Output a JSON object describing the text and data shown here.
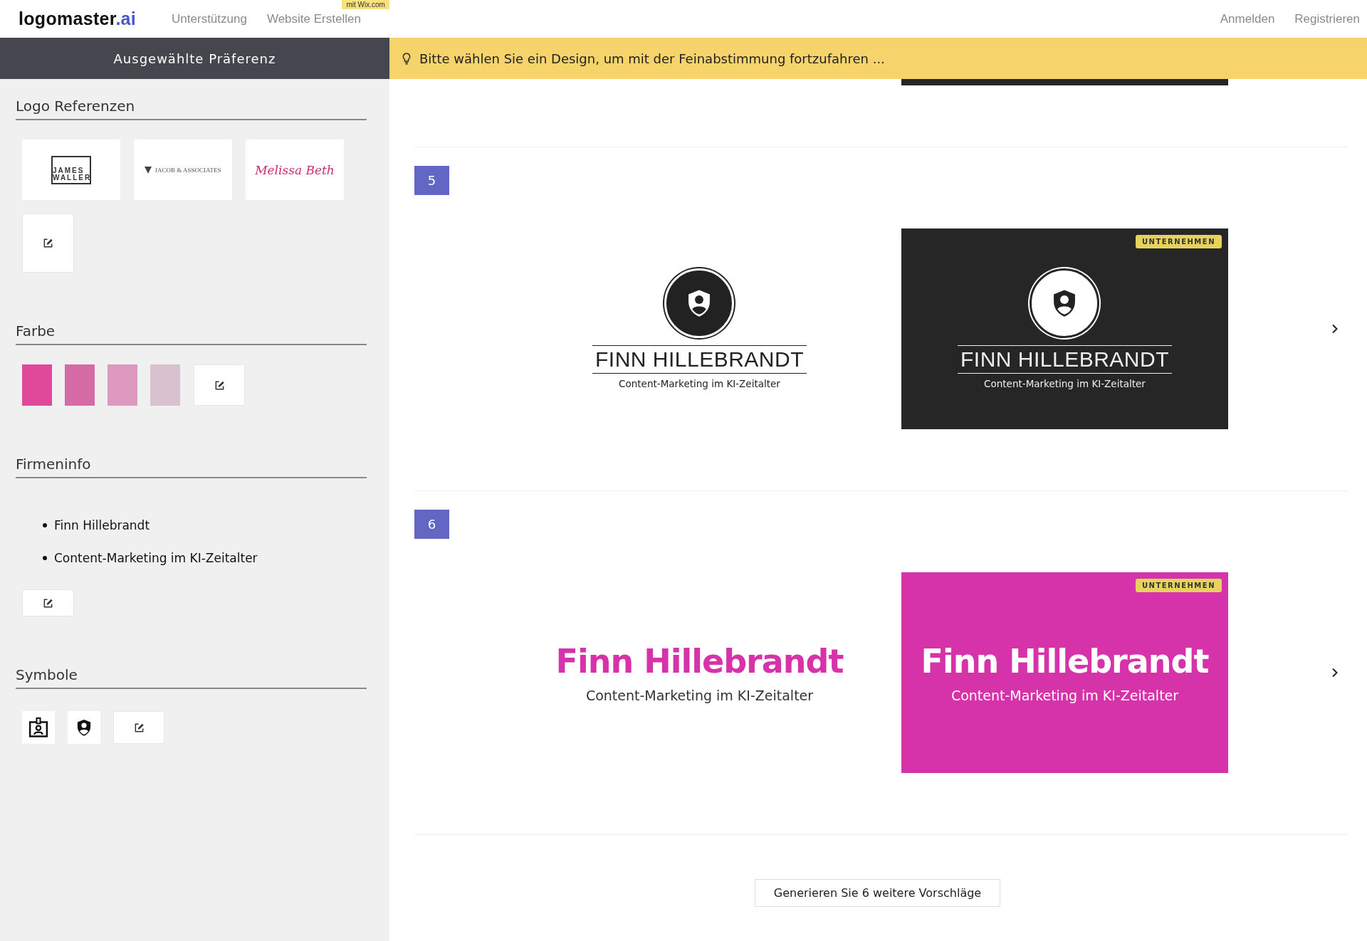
{
  "nav": {
    "logo": {
      "name": "logomaster",
      "suffix": ".ai"
    },
    "links": [
      {
        "label": "Unterstützung"
      },
      {
        "label": "Website Erstellen",
        "tag": "mit Wix.com"
      }
    ],
    "account_links": [
      "Anmelden",
      "Registrieren"
    ]
  },
  "sidebar": {
    "title": "Ausgewählte Präferenz",
    "logo_references": {
      "heading": "Logo Referenzen",
      "items": [
        {
          "kind": "frame",
          "lines": [
            "JAMES",
            "WALLER"
          ]
        },
        {
          "kind": "diamond",
          "lines": [
            "JACOB & ASSOCIATES"
          ]
        },
        {
          "kind": "script",
          "lines": [
            "Melissa Beth"
          ]
        }
      ]
    },
    "colors": {
      "heading": "Farbe",
      "swatches": [
        {
          "color": "#e0489a"
        },
        {
          "color": "#d66aa5"
        },
        {
          "color": "#dd99c0"
        },
        {
          "color": "#d9c2cf"
        }
      ]
    },
    "company_info": {
      "heading": "Firmeninfo",
      "items": [
        "Finn Hillebrandt",
        "Content-Marketing im KI-Zeitalter"
      ]
    },
    "symbols": {
      "heading": "Symbole",
      "items": [
        {
          "kind": "badge"
        },
        {
          "kind": "shield"
        }
      ]
    }
  },
  "banner": {
    "text": "Bitte wählen Sie ein Design, um mit der Feinabstimmung fortzufahren ..."
  },
  "designs": [
    {
      "number": "5",
      "kind": "emblem",
      "previews": [
        {
          "kind": "light",
          "name": "FINN HILLEBRANDT",
          "tagline": "Content-Marketing im KI-Zeitalter"
        },
        {
          "kind": "dark",
          "name": "FINN HILLEBRANDT",
          "tagline": "Content-Marketing im KI-Zeitalter",
          "badge": "UNTERNEHMEN",
          "color": "#262626"
        }
      ]
    },
    {
      "number": "6",
      "kind": "script",
      "previews": [
        {
          "kind": "light",
          "name": "Finn Hillebrandt",
          "tagline": "Content-Marketing im KI-Zeitalter"
        },
        {
          "kind": "dark",
          "name": "Finn Hillebrandt",
          "tagline": "Content-Marketing im KI-Zeitalter",
          "badge": "UNTERNEHMEN",
          "color": "#d633aa"
        }
      ]
    }
  ],
  "generate_button": "Generieren Sie 6 weitere Vorschläge"
}
